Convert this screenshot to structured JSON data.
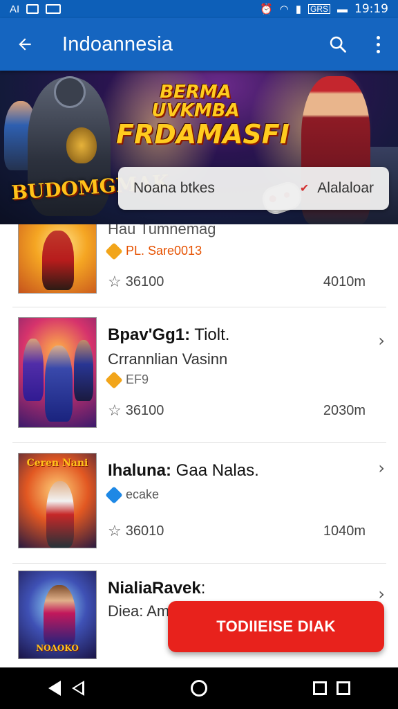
{
  "status_bar": {
    "left_text": "AI",
    "time": "19:19",
    "battery_label": "GRS",
    "icons": [
      "sim-icon",
      "image-icon",
      "alarm-icon",
      "wifi-icon",
      "signal-icon",
      "battery-icon"
    ]
  },
  "app_bar": {
    "title": "Indoannesia",
    "icons": [
      "back-arrow-icon",
      "search-icon",
      "more-vert-icon"
    ]
  },
  "banner": {
    "title_line1": "BERMA UVKMBA",
    "title_line2": "FRDAMASFI",
    "logo_text": "BUDOMGMAK"
  },
  "sort_pill": {
    "left_label": "Noana btkes",
    "right_label": "Alalaloar"
  },
  "list": {
    "items": [
      {
        "title_bold": "",
        "title_rest": "Hau Tumnemag",
        "subtitle": "",
        "tag_label": "PL. Sare0013",
        "tag_color": "#e65100",
        "rating": "36100",
        "size": "4010m",
        "thumb_caption": ""
      },
      {
        "title_bold": "Bpav'Gg1:",
        "title_rest": " Tiolt.",
        "subtitle": "Crrannlian Vasinn",
        "tag_label": "EF9",
        "tag_color": "#f2a51a",
        "rating": "36100",
        "size": "2030m",
        "thumb_caption": ""
      },
      {
        "title_bold": "Ihaluna:",
        "title_rest": " Gaa Nalas.",
        "subtitle": "",
        "tag_label": "ecake",
        "tag_color": "#1e88e5",
        "rating": "36010",
        "size": "1040m",
        "thumb_caption": "Ceren Nani"
      },
      {
        "title_bold": "NialiaRavek",
        "title_rest": ":",
        "subtitle": "Diea: Am",
        "tag_label": "",
        "tag_color": "",
        "rating": "",
        "size": "",
        "thumb_caption": "NOAOKO"
      }
    ]
  },
  "cta_button": {
    "label": "TODIIEISE DIAK",
    "color": "#e8221c"
  },
  "colors": {
    "app_bar": "#1565c0",
    "status_bar": "#0d5fb8"
  }
}
